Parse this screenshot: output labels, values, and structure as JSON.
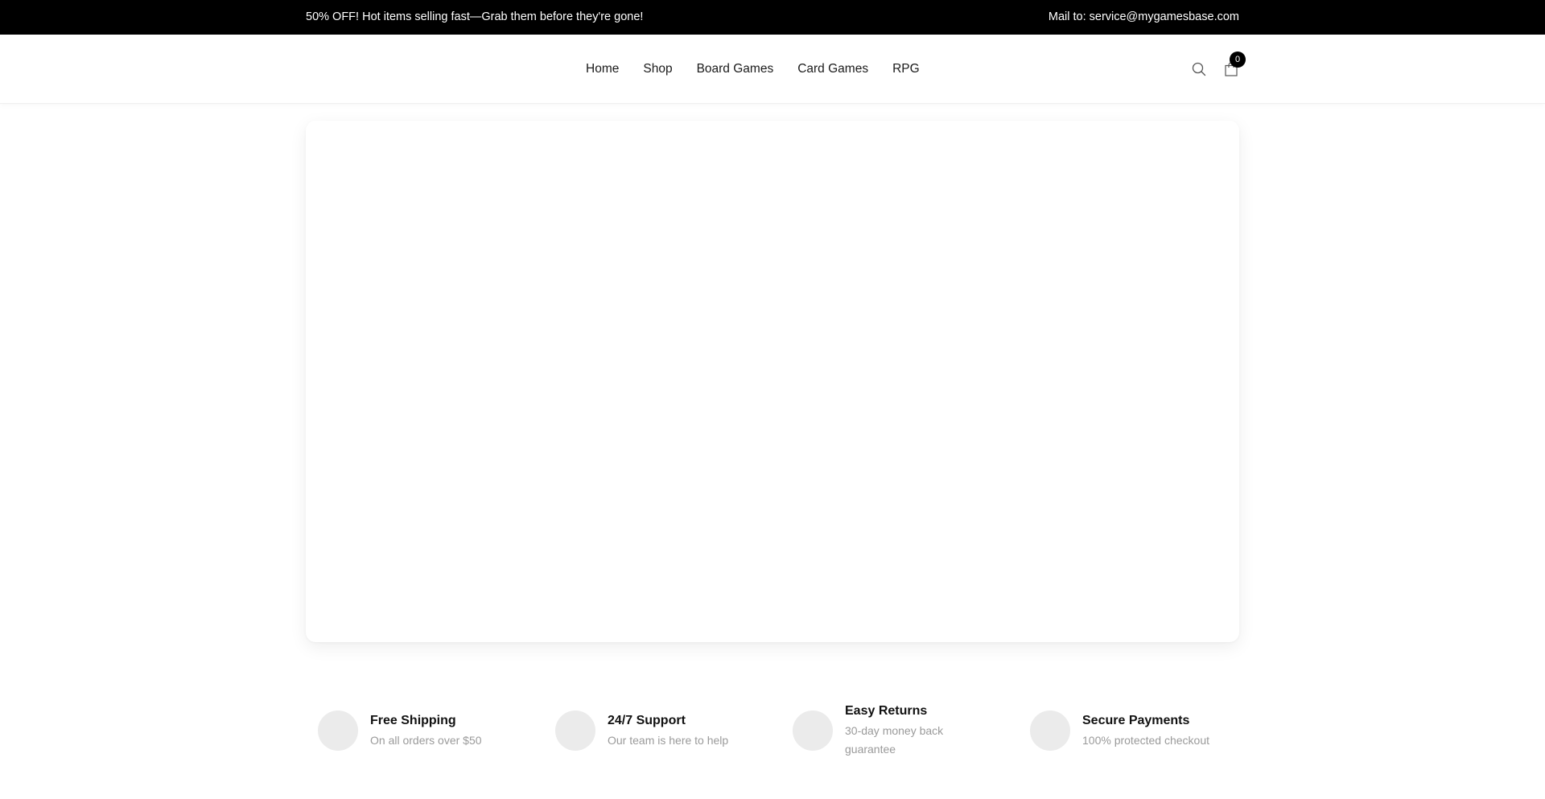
{
  "topbar": {
    "promo": "50% OFF! Hot items selling fast—Grab them before they're gone!",
    "mail": "Mail to: service@mygamesbase.com"
  },
  "nav": {
    "items": [
      "Home",
      "Shop",
      "Board Games",
      "Card Games",
      "RPG"
    ]
  },
  "header": {
    "search_icon": "search-icon",
    "cart_icon": "shopping-bag-icon",
    "cart_count": "0"
  },
  "features": [
    {
      "title": "Free Shipping",
      "subtitle": "On all orders over $50"
    },
    {
      "title": "24/7 Support",
      "subtitle": "Our team is here to help"
    },
    {
      "title": "Easy Returns",
      "subtitle": "30-day money back guarantee"
    },
    {
      "title": "Secure Payments",
      "subtitle": "100% protected checkout"
    }
  ],
  "colors": {
    "topbar_bg": "#000000",
    "topbar_text": "#ffffff",
    "feature_circle": "#ebebeb",
    "feature_subtitle": "#9a9a9a"
  }
}
